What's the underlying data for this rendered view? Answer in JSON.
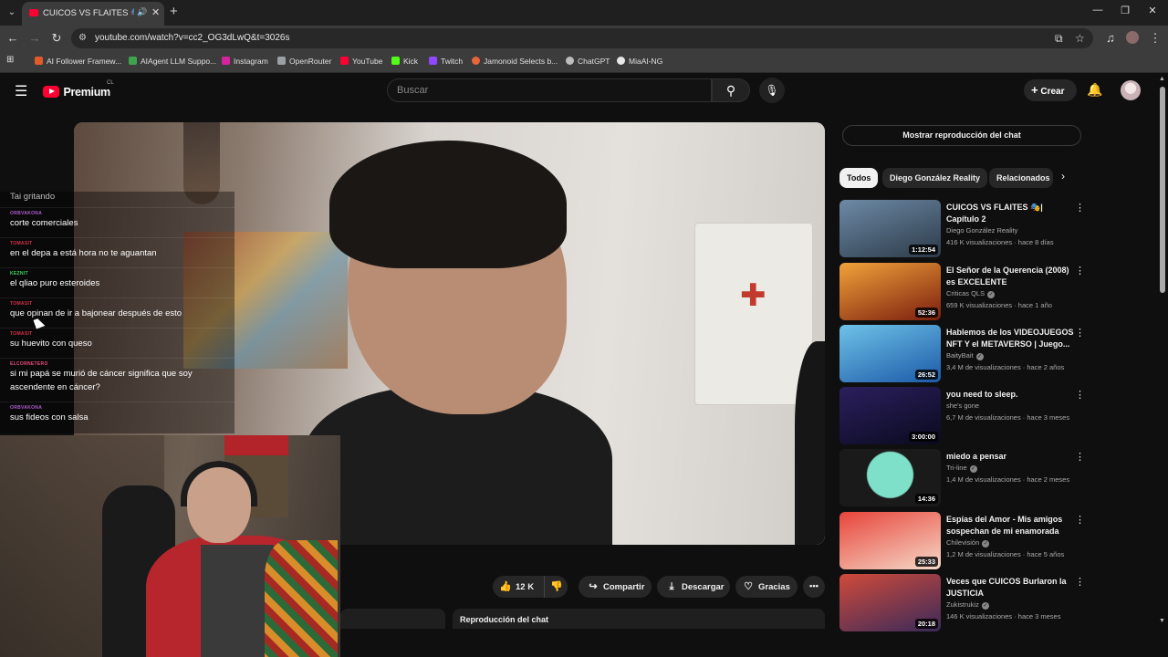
{
  "browser": {
    "tab": {
      "title": "CUICOS VS FLAITES 🎭| Capítulo 2"
    },
    "url": "youtube.com/watch?v=cc2_OG3dLwQ&t=3026s",
    "bookmarks": [
      {
        "label": "AI Follower Framew...",
        "color": "#e05a2a"
      },
      {
        "label": "AIAgent LLM Suppo...",
        "color": "#3fa34d"
      },
      {
        "label": "Instagram",
        "color": "#d6249f"
      },
      {
        "label": "OpenRouter",
        "color": "#9aa0a6"
      },
      {
        "label": "YouTube",
        "color": "#ff0033"
      },
      {
        "label": "Kick",
        "color": "#53fc18"
      },
      {
        "label": "Twitch",
        "color": "#9146ff"
      },
      {
        "label": "Jamonoid Selects b...",
        "color": "#e8663a"
      },
      {
        "label": "ChatGPT",
        "color": "#bdbdbd"
      },
      {
        "label": "MiaAI-NG",
        "color": "#e8e8e8"
      }
    ]
  },
  "header": {
    "logo_text": "Premium",
    "country": "CL",
    "search_placeholder": "Buscar",
    "create_label": "Crear"
  },
  "chat_overlay": [
    {
      "user": "",
      "text": "Tai gritando",
      "color": "#aaaaaa"
    },
    {
      "user": "ORBVAKONA",
      "text": "corte comerciales",
      "color": "#b15bd1"
    },
    {
      "user": "TOMASIT",
      "text": "en el depa a está hora no te aguantan",
      "color": "#d9314a"
    },
    {
      "user": "KEZNIT",
      "text": "el qliao puro esteroides",
      "color": "#3fd45a"
    },
    {
      "user": "TOMASIT",
      "text": "que opinan de ir a bajonear después de esto",
      "color": "#d9314a"
    },
    {
      "user": "TOMASIT",
      "text": "su huevito con queso",
      "color": "#d9314a"
    },
    {
      "user": "ELCORNETERO",
      "text": "si mi papá se murió de cáncer significa que soy ascendente en cáncer?",
      "color": "#e84a7a"
    },
    {
      "user": "ORBVAKONA",
      "text": "sus fideos con salsa",
      "color": "#b15bd1"
    }
  ],
  "actions": {
    "likes": "12 K",
    "share": "Compartir",
    "download": "Descargar",
    "thanks": "Gracias"
  },
  "below": {
    "chat_replay": "Reproducción del chat"
  },
  "sidebar": {
    "chat_replay_button": "Mostrar reproducción del chat",
    "chips": [
      "Todos",
      "Diego González Reality",
      "Relacionados"
    ],
    "recommendations": [
      {
        "title": "CUICOS VS FLAITES 🎭| Capítulo 2",
        "channel": "Diego González Reality",
        "verified": false,
        "meta": "416 K visualizaciones · hace 8 días",
        "duration": "1:12:54",
        "thumb": [
          "#6d8aa6",
          "#2c3a48"
        ]
      },
      {
        "title": "El Señor de la Querencia (2008) es EXCELENTE",
        "channel": "Criticas QLS",
        "verified": true,
        "meta": "659 K visualizaciones · hace 1 año",
        "duration": "52:36",
        "thumb": [
          "#f2a23a",
          "#7a1e0e"
        ]
      },
      {
        "title": "Hablemos de los VIDEOJUEGOS NFT Y el METAVERSO | Juego...",
        "channel": "BaityBait",
        "verified": true,
        "meta": "3,4 M de visualizaciones · hace 2 años",
        "duration": "26:52",
        "thumb": [
          "#6ec2e8",
          "#1c5aa8"
        ]
      },
      {
        "title": "you need to sleep.",
        "channel": "she's gone",
        "verified": false,
        "meta": "6,7 M de visualizaciones · hace 3 meses",
        "duration": "3:00:00",
        "thumb": [
          "#2b1f5e",
          "#0a0a1e"
        ]
      },
      {
        "title": "miedo a pensar",
        "channel": "Tri-line",
        "verified": true,
        "meta": "1,4 M de visualizaciones · hace 2 meses",
        "duration": "14:36",
        "thumb": [
          "#7ee0c8",
          "#1a1a1a"
        ]
      },
      {
        "title": "Espías del Amor - Mis amigos sospechan de mi enamorada",
        "channel": "Chilevisión",
        "verified": true,
        "meta": "1,2 M de visualizaciones · hace 5 años",
        "duration": "25:33",
        "thumb": [
          "#e8443a",
          "#f5d9c8"
        ]
      },
      {
        "title": "Veces que CUICOS Burlaron la JUSTICIA",
        "channel": "Zukistrukiz",
        "verified": true,
        "meta": "146 K visualizaciones · hace 3 meses",
        "duration": "20:18",
        "thumb": [
          "#d04a3a",
          "#3a2a5a"
        ]
      }
    ]
  }
}
